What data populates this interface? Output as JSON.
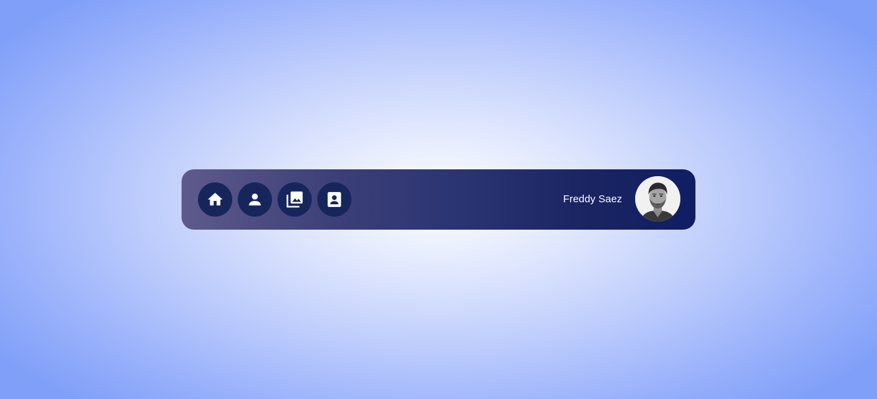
{
  "nav": {
    "items": [
      {
        "icon": "home-icon"
      },
      {
        "icon": "person-icon"
      },
      {
        "icon": "photo-library-icon"
      },
      {
        "icon": "contact-card-icon"
      }
    ]
  },
  "user": {
    "name": "Freddy Saez",
    "avatar_icon": "avatar-photo"
  },
  "colors": {
    "button_bg": "#16265c",
    "bar_start": "#5e5a8c",
    "bar_end": "#0f1d63"
  }
}
